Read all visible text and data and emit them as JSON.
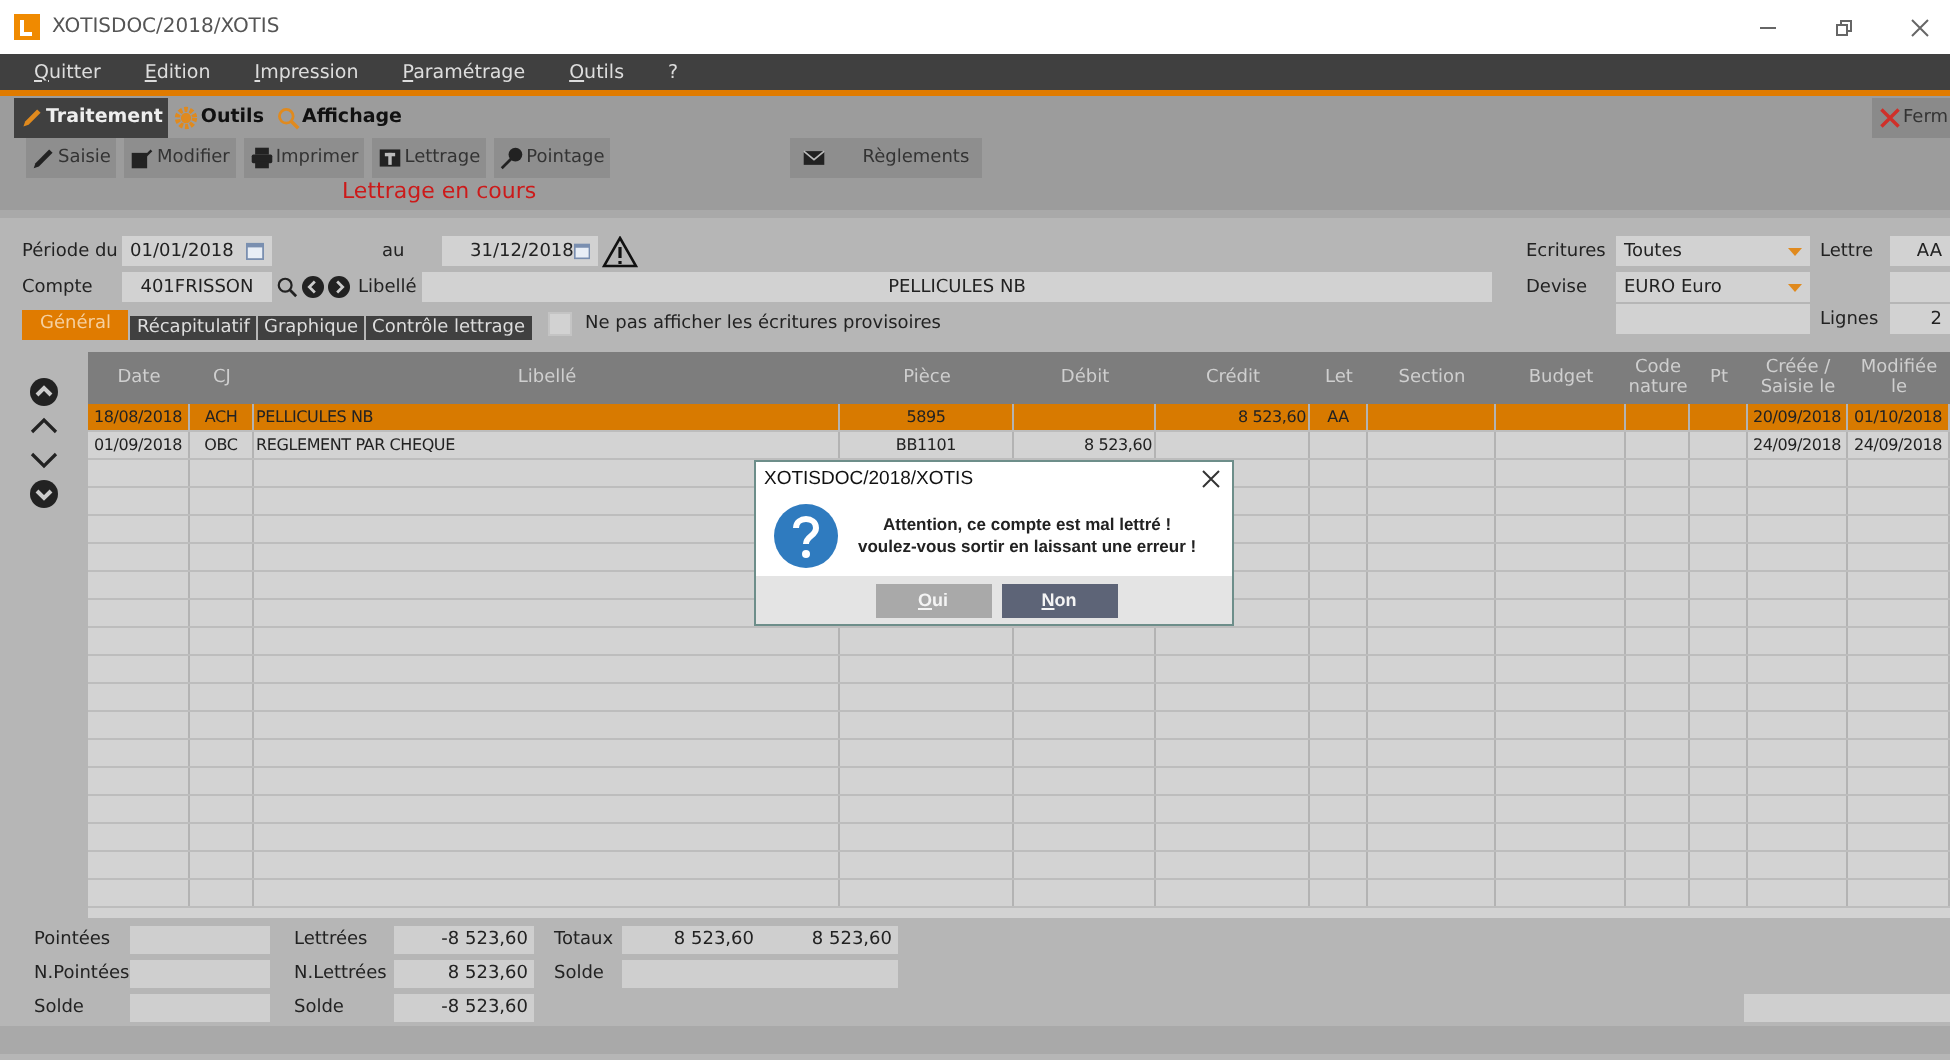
{
  "window": {
    "title": "XOTISDOC/2018/XOTIS"
  },
  "menu": [
    {
      "label": "Quitter"
    },
    {
      "label": "Edition"
    },
    {
      "label": "Impression"
    },
    {
      "label": "Paramétrage"
    },
    {
      "label": "Outils"
    },
    {
      "label": "?"
    }
  ],
  "ribbon_tabs": [
    {
      "label": "Traitement",
      "selected": true
    },
    {
      "label": "Outils",
      "selected": false
    },
    {
      "label": "Affichage",
      "selected": false
    }
  ],
  "close_button": {
    "label": "Ferm"
  },
  "toolbar": [
    {
      "label": "Saisie"
    },
    {
      "label": "Modifier"
    },
    {
      "label": "Imprimer"
    },
    {
      "label": "Lettrage"
    },
    {
      "label": "Pointage"
    },
    {
      "label": "Règlements"
    }
  ],
  "status_message": "Lettrage en cours",
  "filters": {
    "period_from_label": "Période du",
    "period_from": "01/01/2018",
    "period_to_label": "au",
    "period_to": "31/12/2018",
    "account_label": "Compte",
    "account": "401FRISSON",
    "libelle_label": "Libellé",
    "libelle": "PELLICULES NB",
    "ecritures_label": "Ecritures",
    "ecritures": "Toutes",
    "devise_label": "Devise",
    "devise": "EURO Euro",
    "lettre_label": "Lettre",
    "lettre": "AA",
    "lignes_label": "Lignes",
    "lignes": "2"
  },
  "view_tabs": [
    {
      "label": "Général",
      "selected": true
    },
    {
      "label": "Récapitulatif",
      "selected": false
    },
    {
      "label": "Graphique",
      "selected": false
    },
    {
      "label": "Contrôle lettrage",
      "selected": false
    }
  ],
  "provisional_checkbox": {
    "label": "Ne pas afficher les écritures provisoires",
    "checked": false
  },
  "table": {
    "columns": [
      "Date",
      "CJ",
      "Libellé",
      "Pièce",
      "Débit",
      "Crédit",
      "Let",
      "Section",
      "Budget",
      "Code nature",
      "Pt",
      "Créée / Saisie le",
      "Modifiée le"
    ],
    "rows": [
      {
        "selected": true,
        "cells": [
          "18/08/2018",
          "ACH",
          "PELLICULES NB",
          "5895",
          "",
          "8 523,60",
          "AA",
          "",
          "",
          "",
          "",
          "20/09/2018",
          "01/10/2018"
        ]
      },
      {
        "selected": false,
        "cells": [
          "01/09/2018",
          "OBC",
          "REGLEMENT PAR CHEQUE",
          "BB1101",
          "8 523,60",
          "",
          "",
          "",
          "",
          "",
          "",
          "24/09/2018",
          "24/09/2018"
        ]
      }
    ]
  },
  "footer": {
    "pointage": [
      {
        "label": "Pointées"
      },
      {
        "label": "N.Pointées"
      },
      {
        "label": "Solde"
      }
    ],
    "lettrage": [
      {
        "label": "Lettrées",
        "value": "-8 523,60"
      },
      {
        "label": "N.Lettrées",
        "value": "8 523,60"
      },
      {
        "label": "Solde",
        "value": "-8 523,60"
      }
    ],
    "totals": [
      {
        "label": "Totaux",
        "values": [
          "8 523,60",
          "8 523,60"
        ]
      },
      {
        "label": "Solde"
      }
    ]
  },
  "dialog": {
    "title": "XOTISDOC/2018/XOTIS",
    "message": [
      "Attention, ce compte est mal lettré !",
      "voulez-vous sortir en laissant une erreur !"
    ],
    "buttons": [
      {
        "label": "Oui",
        "selected": false
      },
      {
        "label": "Non",
        "selected": true
      }
    ]
  }
}
